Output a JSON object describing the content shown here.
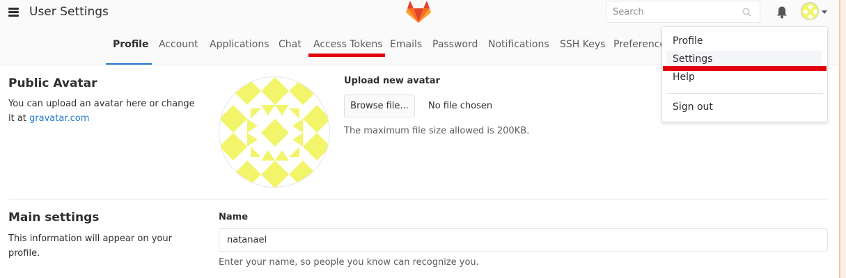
{
  "header": {
    "app_title": "User Settings",
    "search": {
      "placeholder": "Search"
    }
  },
  "nav": {
    "tabs": [
      {
        "label": "Profile",
        "active": true
      },
      {
        "label": "Account"
      },
      {
        "label": "Applications"
      },
      {
        "label": "Chat"
      },
      {
        "label": "Access Tokens",
        "annotated": true
      },
      {
        "label": "Emails"
      },
      {
        "label": "Password"
      },
      {
        "label": "Notifications"
      },
      {
        "label": "SSH Keys"
      },
      {
        "label": "Preferences"
      }
    ]
  },
  "user_menu": {
    "items": [
      {
        "label": "Profile"
      },
      {
        "label": "Settings",
        "highlighted": true,
        "annotated": true
      },
      {
        "label": "Help"
      },
      {
        "label": "Sign out"
      }
    ]
  },
  "avatar_section": {
    "title": "Public Avatar",
    "description": "You can upload an avatar here or change it at",
    "link": "gravatar.com",
    "upload_title": "Upload new avatar",
    "browse_label": "Browse file...",
    "file_status": "No file chosen",
    "size_note": "The maximum file size allowed is 200KB."
  },
  "main_settings": {
    "title": "Main settings",
    "description": "This information will appear on your profile.",
    "name_label": "Name",
    "name_value": "natanael",
    "name_help": "Enter your name, so people you know can recognize you."
  },
  "colors": {
    "accent_blue": "#1f78d1",
    "annotation_red": "#e3000b",
    "avatar_yellow": "#f2f56a",
    "logo_orange": "#fc6d26"
  }
}
